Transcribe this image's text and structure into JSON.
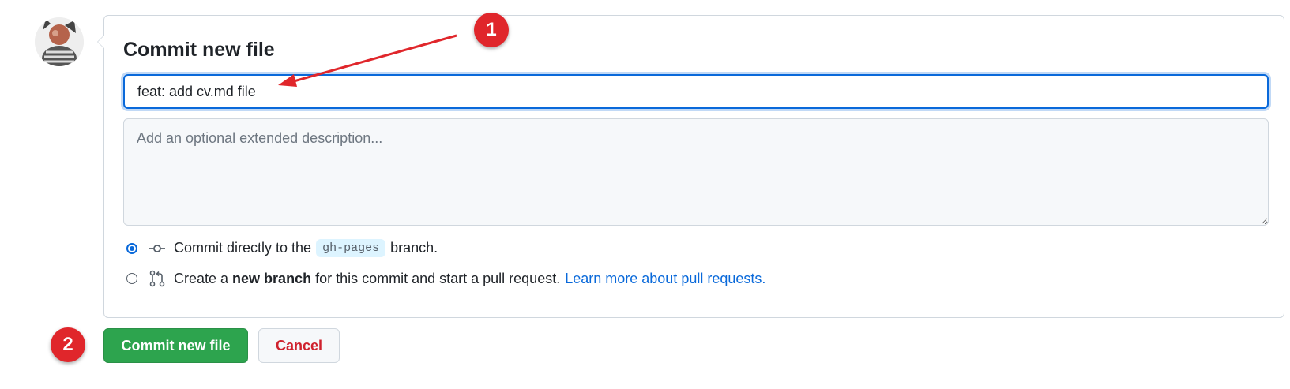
{
  "avatar": {
    "alt": "user avatar"
  },
  "commit": {
    "title": "Commit new file",
    "summary_value": "feat: add cv.md file",
    "description_placeholder": "Add an optional extended description..."
  },
  "options": {
    "direct": {
      "prefix": "Commit directly to the",
      "branch": "gh-pages",
      "suffix": "branch.",
      "checked": true
    },
    "new_branch": {
      "prefix": "Create a",
      "bold": "new branch",
      "suffix": "for this commit and start a pull request.",
      "link": "Learn more about pull requests.",
      "checked": false
    }
  },
  "buttons": {
    "commit_label": "Commit new file",
    "cancel_label": "Cancel"
  },
  "annotations": {
    "badge1": "1",
    "badge2": "2"
  },
  "colors": {
    "primary": "#2da44e",
    "focus": "#0969da",
    "danger": "#cf222e",
    "annotation": "#e0262b"
  }
}
